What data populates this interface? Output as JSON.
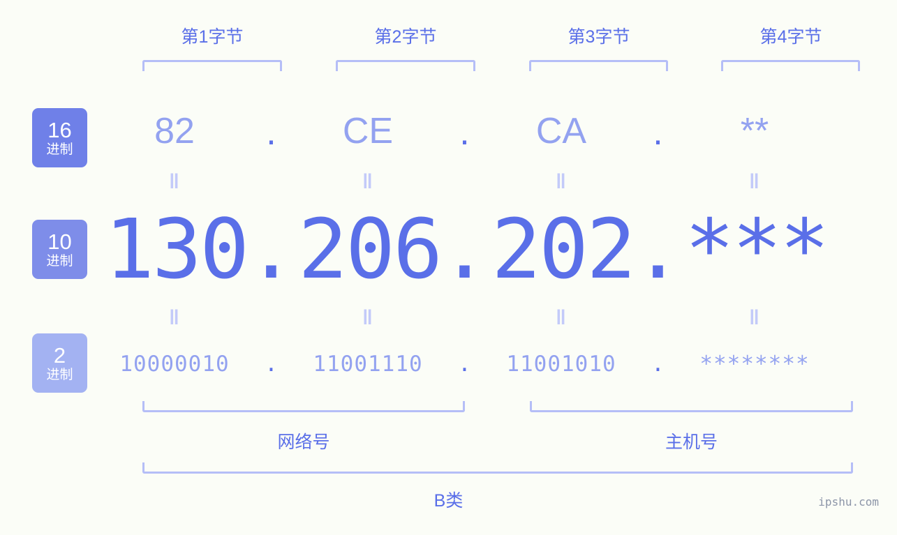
{
  "colors": {
    "background": "#fbfdf7",
    "accent_strong": "#5a6fe8",
    "accent_mid": "#93a2f0",
    "accent_light": "#b5bef7",
    "badge_hex": "#6f80e8",
    "badge_dec": "#7e8de9",
    "badge_bin": "#a3b2f2",
    "eq_mark": "#c3caf9",
    "watermark": "#8c95a8"
  },
  "byte_headers": [
    {
      "label": "第1字节"
    },
    {
      "label": "第2字节"
    },
    {
      "label": "第3字节"
    },
    {
      "label": "第4字节"
    }
  ],
  "badges": {
    "hex": {
      "number": "16",
      "unit": "进制"
    },
    "decimal": {
      "number": "10",
      "unit": "进制"
    },
    "binary": {
      "number": "2",
      "unit": "进制"
    }
  },
  "separator": ".",
  "rows": {
    "hex": {
      "values": [
        "82",
        "CE",
        "CA",
        "**"
      ]
    },
    "decimal": {
      "values": [
        "130",
        "206",
        "202",
        "***"
      ]
    },
    "binary": {
      "values": [
        "10000010",
        "11001110",
        "11001010",
        "********"
      ]
    }
  },
  "equals_mark": "‖",
  "sections": {
    "network": {
      "label": "网络号"
    },
    "host": {
      "label": "主机号"
    }
  },
  "ip_class": {
    "label": "B类"
  },
  "watermark": {
    "text": "ipshu.com"
  }
}
